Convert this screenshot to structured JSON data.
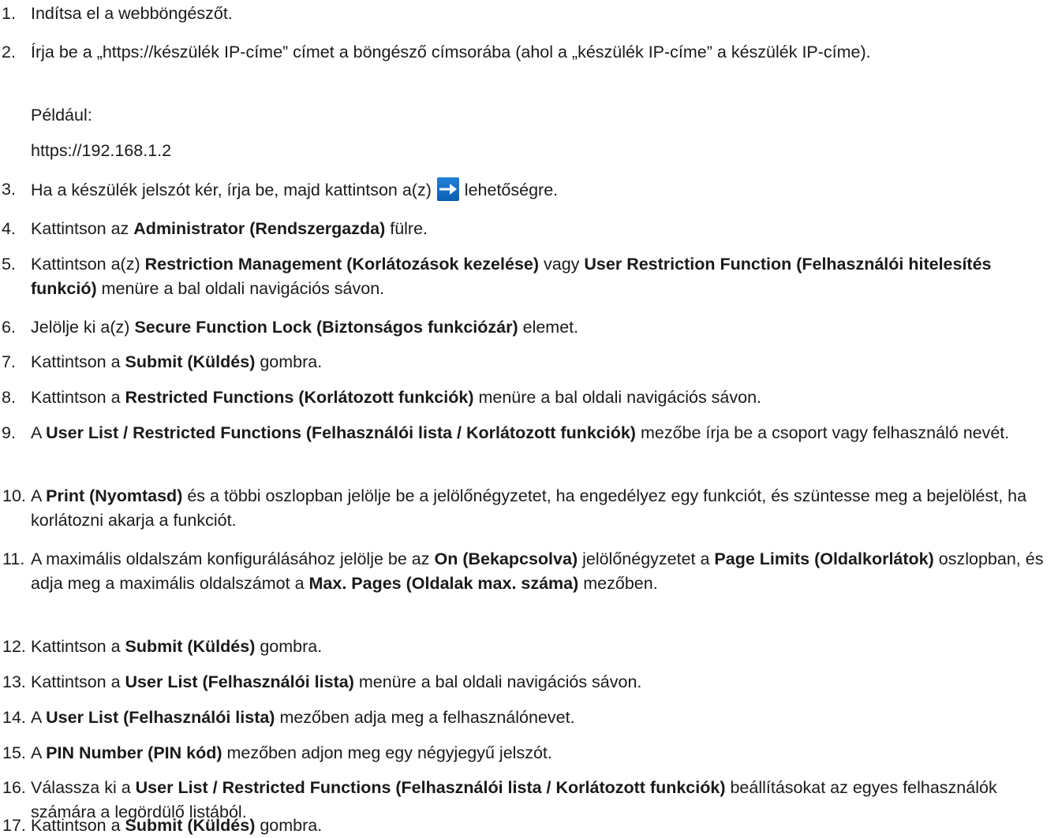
{
  "steps": [
    {
      "num": "1.",
      "parts": [
        "Indítsa el a webböngészőt."
      ]
    },
    {
      "num": "2.",
      "parts": [
        "Írja be a „https://készülék IP-címe” címet a böngésző címsorába (ahol a „készülék IP-címe” a készülék IP-címe)."
      ],
      "example_label": "Például:",
      "example_value": "https://192.168.1.2"
    },
    {
      "num": "3.",
      "parts": [
        "Ha a készülék jelszót kér, írja be, majd kattintson a(z) ",
        " lehetőségre."
      ],
      "icon": "arrow-right-icon"
    },
    {
      "num": "4.",
      "parts": [
        "Kattintson az ",
        "Administrator (Rendszergazda)",
        " fülre."
      ]
    },
    {
      "num": "5.",
      "parts": [
        "Kattintson a(z) ",
        "Restriction Management (Korlátozások kezelése)",
        " vagy ",
        "User Restriction Function (Felhasználói hitelesítés funkció)",
        " menüre a bal oldali navigációs sávon."
      ]
    },
    {
      "num": "6.",
      "parts": [
        "Jelölje ki a(z) ",
        "Secure Function Lock (Biztonságos funkciózár)",
        " elemet."
      ]
    },
    {
      "num": "7.",
      "parts": [
        "Kattintson a ",
        "Submit (Küldés)",
        " gombra."
      ]
    },
    {
      "num": "8.",
      "parts": [
        "Kattintson a ",
        "Restricted Functions (Korlátozott funkciók)",
        " menüre a bal oldali navigációs sávon."
      ]
    },
    {
      "num": "9.",
      "parts": [
        "A ",
        "User List / Restricted Functions (Felhasználói lista / Korlátozott funkciók)",
        " mezőbe írja be a csoport vagy felhasználó nevét."
      ]
    },
    {
      "num": "10.",
      "parts": [
        "A ",
        "Print (Nyomtasd)",
        " és a többi oszlopban jelölje be a jelölőnégyzetet, ha engedélyez egy funkciót, és szüntesse meg a bejelölést, ha korlátozni akarja a funkciót."
      ]
    },
    {
      "num": "11.",
      "parts": [
        "A maximális oldalszám konfigurálásához jelölje be az ",
        "On (Bekapcsolva)",
        " jelölőnégyzetet a ",
        "Page Limits (Oldalkorlátok)",
        " oszlopban, és adja meg a maximális oldalszámot a ",
        "Max. Pages (Oldalak max. száma)",
        " mezőben."
      ]
    },
    {
      "num": "12.",
      "parts": [
        "Kattintson a ",
        "Submit (Küldés)",
        " gombra."
      ]
    },
    {
      "num": "13.",
      "parts": [
        "Kattintson a ",
        "User List (Felhasználói lista)",
        " menüre a bal oldali navigációs sávon."
      ]
    },
    {
      "num": "14.",
      "parts": [
        "A ",
        "User List (Felhasználói lista)",
        " mezőben adja meg a felhasználónevet."
      ]
    },
    {
      "num": "15.",
      "parts": [
        "A ",
        "PIN Number (PIN kód)",
        " mezőben adjon meg egy négyjegyű jelszót."
      ]
    },
    {
      "num": "16.",
      "parts": [
        "Válassza ki a ",
        "User List / Restricted Functions (Felhasználói lista / Korlátozott funkciók)",
        " beállításokat az egyes felhasználók számára a legördülő listából."
      ]
    },
    {
      "num": "17.",
      "parts": [
        "Kattintson a ",
        "Submit (Küldés)",
        " gombra."
      ]
    }
  ],
  "colors": {
    "text": "#1a1a1a",
    "icon_blue": "#1f7fd6"
  }
}
